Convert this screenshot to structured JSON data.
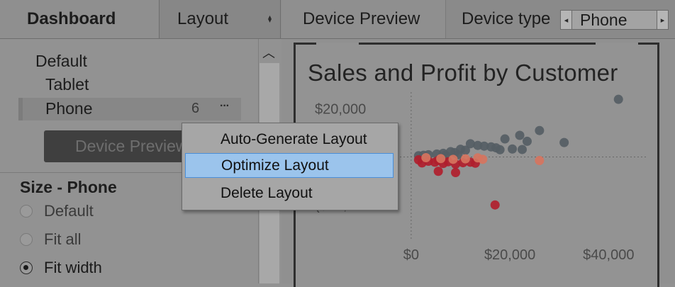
{
  "tabs": {
    "dashboard": "Dashboard",
    "layout": "Layout",
    "device_preview": "Device Preview",
    "device_type_label": "Device type",
    "device_type_value": "Phone"
  },
  "layouts": {
    "items": [
      "Default",
      "Tablet",
      "Phone"
    ],
    "phone_touch_icon": "6",
    "more_icon": "···",
    "selected": "Phone"
  },
  "device_preview_button": "Device Preview",
  "size": {
    "title": "Size - Phone",
    "options": [
      "Default",
      "Fit all",
      "Fit width"
    ],
    "selected": "Fit width"
  },
  "context_menu": {
    "items": [
      "Auto-Generate Layout",
      "Optimize Layout",
      "Delete Layout"
    ],
    "highlighted": "Optimize Layout"
  },
  "chart_data": {
    "type": "scatter",
    "title": "Sales and Profit by Customer",
    "y_ticks": [
      "$20,000",
      "($20,0.."
    ],
    "x_ticks": [
      "$0",
      "$20,000",
      "$40,000"
    ],
    "xlim": [
      -3000,
      48000
    ],
    "ylim": [
      -35000,
      27000
    ],
    "grid": "dotted zero lines",
    "series": [
      {
        "color": "#555d64",
        "points": [
          [
            42000,
            24000
          ],
          [
            26000,
            11000
          ],
          [
            22000,
            9000
          ],
          [
            19000,
            7500
          ],
          [
            23500,
            6500
          ],
          [
            31000,
            6000
          ],
          [
            12000,
            5500
          ],
          [
            13500,
            4800
          ],
          [
            14800,
            4500
          ],
          [
            16200,
            4200
          ],
          [
            17200,
            3800
          ],
          [
            10000,
            3200
          ],
          [
            11000,
            2800
          ],
          [
            8000,
            2200
          ],
          [
            8800,
            1800
          ],
          [
            6500,
            1500
          ],
          [
            5200,
            1200
          ],
          [
            3500,
            900
          ],
          [
            2500,
            700
          ],
          [
            1500,
            500
          ],
          [
            7000,
            600
          ],
          [
            9500,
            900
          ],
          [
            18000,
            3000
          ],
          [
            20500,
            3300
          ],
          [
            22500,
            3100
          ]
        ]
      },
      {
        "color": "#b01e2c",
        "points": [
          [
            1500,
            -1200
          ],
          [
            2200,
            -2500
          ],
          [
            3500,
            -1800
          ],
          [
            4800,
            -2200
          ],
          [
            5500,
            -1400
          ],
          [
            6500,
            -2700
          ],
          [
            7500,
            -2000
          ],
          [
            9000,
            -3000
          ],
          [
            10500,
            -2400
          ],
          [
            12000,
            -2200
          ],
          [
            13000,
            -2600
          ],
          [
            5500,
            -6000
          ],
          [
            9000,
            -6500
          ],
          [
            17000,
            -20000
          ]
        ]
      },
      {
        "color": "#d6745e",
        "points": [
          [
            3000,
            -300
          ],
          [
            6000,
            -700
          ],
          [
            8500,
            -1000
          ],
          [
            11000,
            -800
          ],
          [
            13500,
            -400
          ],
          [
            14500,
            -1000
          ],
          [
            26000,
            -1500
          ]
        ]
      }
    ]
  }
}
